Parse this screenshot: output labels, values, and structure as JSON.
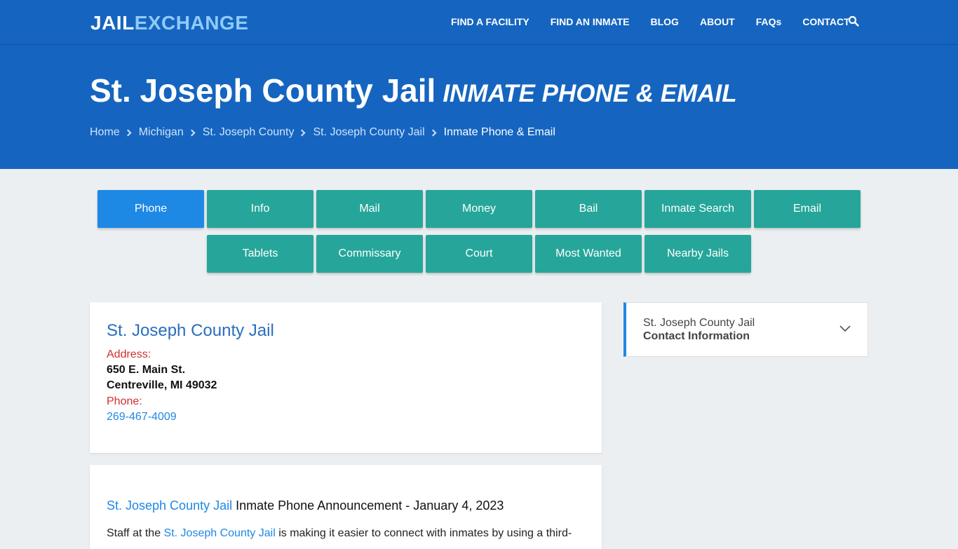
{
  "header": {
    "logo_part1": "JAIL",
    "logo_part2": "EXCHANGE",
    "nav": [
      "FIND A FACILITY",
      "FIND AN INMATE",
      "BLOG",
      "ABOUT",
      "FAQs",
      "CONTACT"
    ]
  },
  "hero": {
    "title": "St. Joseph County Jail",
    "subtitle": "INMATE PHONE & EMAIL",
    "breadcrumbs": [
      "Home",
      "Michigan",
      "St. Joseph County",
      "St. Joseph County Jail",
      "Inmate Phone & Email"
    ]
  },
  "tabs_row1": [
    "Phone",
    "Info",
    "Mail",
    "Money",
    "Bail",
    "Inmate Search",
    "Email"
  ],
  "tabs_row2": [
    "Tablets",
    "Commissary",
    "Court",
    "Most Wanted",
    "Nearby Jails"
  ],
  "facility_card": {
    "title": "St. Joseph County Jail",
    "address_label": "Address:",
    "address_line1": "650 E. Main St.",
    "address_line2": "Centreville, MI 49032",
    "phone_label": "Phone:",
    "phone": "269-467-4009"
  },
  "announcement": {
    "link": "St. Joseph County Jail",
    "heading_rest": " Inmate Phone Announcement - January 4, 2023",
    "para_start": "Staff at the ",
    "para_link": "St. Joseph County Jail",
    "para_rest": " is making it easier to connect with inmates by using a third-"
  },
  "sidebar": {
    "line1": "St. Joseph County Jail",
    "line2": "Contact Information"
  },
  "colors": {
    "brand_blue": "#1565c0",
    "teal": "#26a69a",
    "active_blue": "#1e88e5"
  }
}
